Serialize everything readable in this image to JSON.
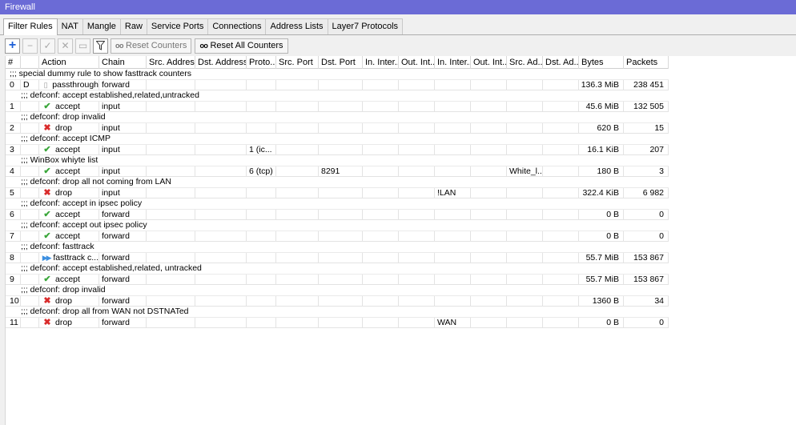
{
  "window": {
    "title": "Firewall"
  },
  "tabs": [
    "Filter Rules",
    "NAT",
    "Mangle",
    "Raw",
    "Service Ports",
    "Connections",
    "Address Lists",
    "Layer7 Protocols"
  ],
  "toolbar": {
    "reset_counters": "Reset Counters",
    "reset_all_counters": "Reset All Counters",
    "counter_glyph": "oo"
  },
  "columns": [
    "#",
    "",
    "Action",
    "Chain",
    "Src. Address",
    "Dst. Address",
    "Proto...",
    "Src. Port",
    "Dst. Port",
    "In. Inter...",
    "Out. Int...",
    "In. Inter...",
    "Out. Int...",
    "Src. Ad...",
    "Dst. Ad...",
    "Bytes",
    "Packets"
  ],
  "rules": [
    {
      "comment": ";;; special dummy rule to show fasttrack counters",
      "num": "0",
      "flag": "D",
      "icon": "passthrough-icon",
      "action": "passthrough",
      "chain": "forward",
      "proto": "",
      "dst_port": "",
      "in_iface_list": "",
      "src_addr_list": "",
      "bytes": "136.3 MiB",
      "packets": "238 451"
    },
    {
      "comment": ";;; defconf: accept established,related,untracked",
      "num": "1",
      "flag": "",
      "icon": "accept-icon",
      "action": "accept",
      "chain": "input",
      "proto": "",
      "dst_port": "",
      "in_iface_list": "",
      "src_addr_list": "",
      "bytes": "45.6 MiB",
      "packets": "132 505"
    },
    {
      "comment": ";;; defconf: drop invalid",
      "num": "2",
      "flag": "",
      "icon": "drop-icon",
      "action": "drop",
      "chain": "input",
      "proto": "",
      "dst_port": "",
      "in_iface_list": "",
      "src_addr_list": "",
      "bytes": "620 B",
      "packets": "15"
    },
    {
      "comment": ";;; defconf: accept ICMP",
      "num": "3",
      "flag": "",
      "icon": "accept-icon",
      "action": "accept",
      "chain": "input",
      "proto": "1 (ic...",
      "dst_port": "",
      "in_iface_list": "",
      "src_addr_list": "",
      "bytes": "16.1 KiB",
      "packets": "207"
    },
    {
      "comment": ";;; WinBox whiyte list",
      "num": "4",
      "flag": "",
      "icon": "accept-icon",
      "action": "accept",
      "chain": "input",
      "proto": "6 (tcp)",
      "dst_port": "8291",
      "in_iface_list": "",
      "src_addr_list": "White_l...",
      "bytes": "180 B",
      "packets": "3"
    },
    {
      "comment": ";;; defconf: drop all not coming from LAN",
      "num": "5",
      "flag": "",
      "icon": "drop-icon",
      "action": "drop",
      "chain": "input",
      "proto": "",
      "dst_port": "",
      "in_iface_list": "!LAN",
      "src_addr_list": "",
      "bytes": "322.4 KiB",
      "packets": "6 982"
    },
    {
      "comment": ";;; defconf: accept in ipsec policy",
      "num": "6",
      "flag": "",
      "icon": "accept-icon",
      "action": "accept",
      "chain": "forward",
      "proto": "",
      "dst_port": "",
      "in_iface_list": "",
      "src_addr_list": "",
      "bytes": "0 B",
      "packets": "0"
    },
    {
      "comment": ";;; defconf: accept out ipsec policy",
      "num": "7",
      "flag": "",
      "icon": "accept-icon",
      "action": "accept",
      "chain": "forward",
      "proto": "",
      "dst_port": "",
      "in_iface_list": "",
      "src_addr_list": "",
      "bytes": "0 B",
      "packets": "0"
    },
    {
      "comment": ";;; defconf: fasttrack",
      "num": "8",
      "flag": "",
      "icon": "fasttrack-icon",
      "action": "fasttrack c...",
      "chain": "forward",
      "proto": "",
      "dst_port": "",
      "in_iface_list": "",
      "src_addr_list": "",
      "bytes": "55.7 MiB",
      "packets": "153 867"
    },
    {
      "comment": ";;; defconf: accept established,related, untracked",
      "num": "9",
      "flag": "",
      "icon": "accept-icon",
      "action": "accept",
      "chain": "forward",
      "proto": "",
      "dst_port": "",
      "in_iface_list": "",
      "src_addr_list": "",
      "bytes": "55.7 MiB",
      "packets": "153 867"
    },
    {
      "comment": ";;; defconf: drop invalid",
      "num": "10",
      "flag": "",
      "icon": "drop-icon",
      "action": "drop",
      "chain": "forward",
      "proto": "",
      "dst_port": "",
      "in_iface_list": "",
      "src_addr_list": "",
      "bytes": "1360 B",
      "packets": "34"
    },
    {
      "comment": ";;; defconf:  drop all from WAN not DSTNATed",
      "num": "11",
      "flag": "",
      "icon": "drop-icon",
      "action": "drop",
      "chain": "forward",
      "proto": "",
      "dst_port": "",
      "in_iface_list": "WAN",
      "src_addr_list": "",
      "bytes": "0 B",
      "packets": "0"
    }
  ],
  "colors": {
    "titlebar": "#6b6bd6",
    "accept": "#3aa63a",
    "drop": "#d92b2b",
    "add": "#1d5fd6"
  }
}
